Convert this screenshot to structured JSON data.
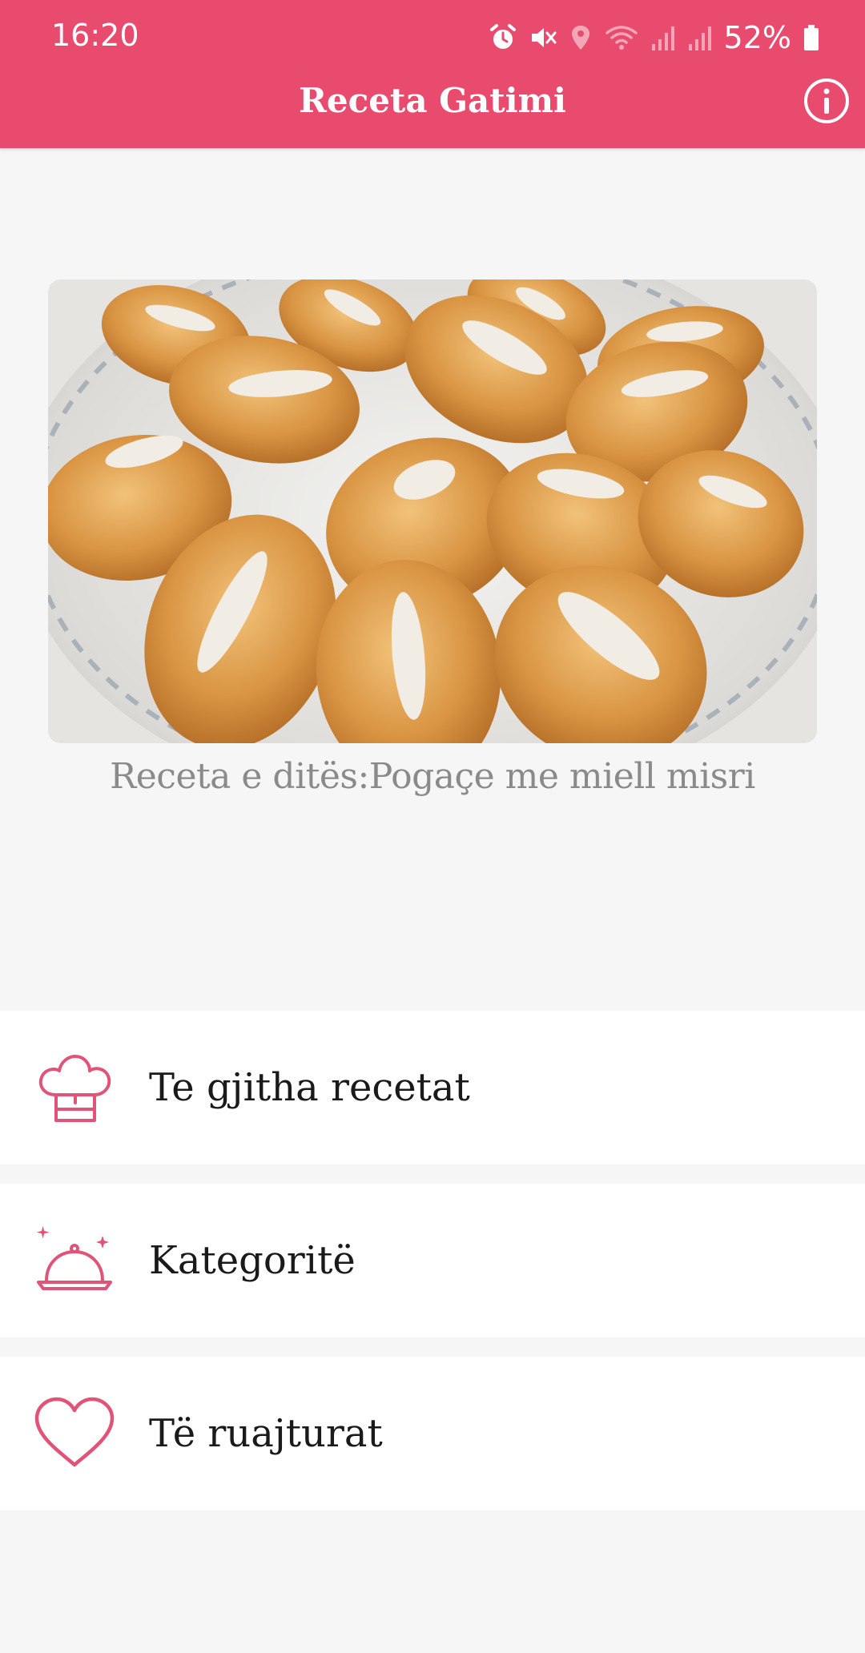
{
  "status_bar": {
    "time": "16:20",
    "battery": "52%",
    "icons": [
      "alarm-icon",
      "mute-icon",
      "location-icon",
      "wifi-icon",
      "signal-icon",
      "signal-icon",
      "battery-icon"
    ]
  },
  "app_bar": {
    "title": "Receta Gatimi",
    "info_icon": "info-icon"
  },
  "recipe_of_day": {
    "caption": "Receta e ditës:Pogaçe me miell misri"
  },
  "menu": {
    "items": [
      {
        "label": "Te gjitha recetat",
        "icon": "chef-hat-icon"
      },
      {
        "label": "Kategoritë",
        "icon": "serving-dish-icon"
      },
      {
        "label": "Të ruajturat",
        "icon": "heart-icon"
      }
    ]
  },
  "colors": {
    "accent": "#e94b6e",
    "background": "#f6f6f6",
    "caption": "#8a8a8a"
  }
}
